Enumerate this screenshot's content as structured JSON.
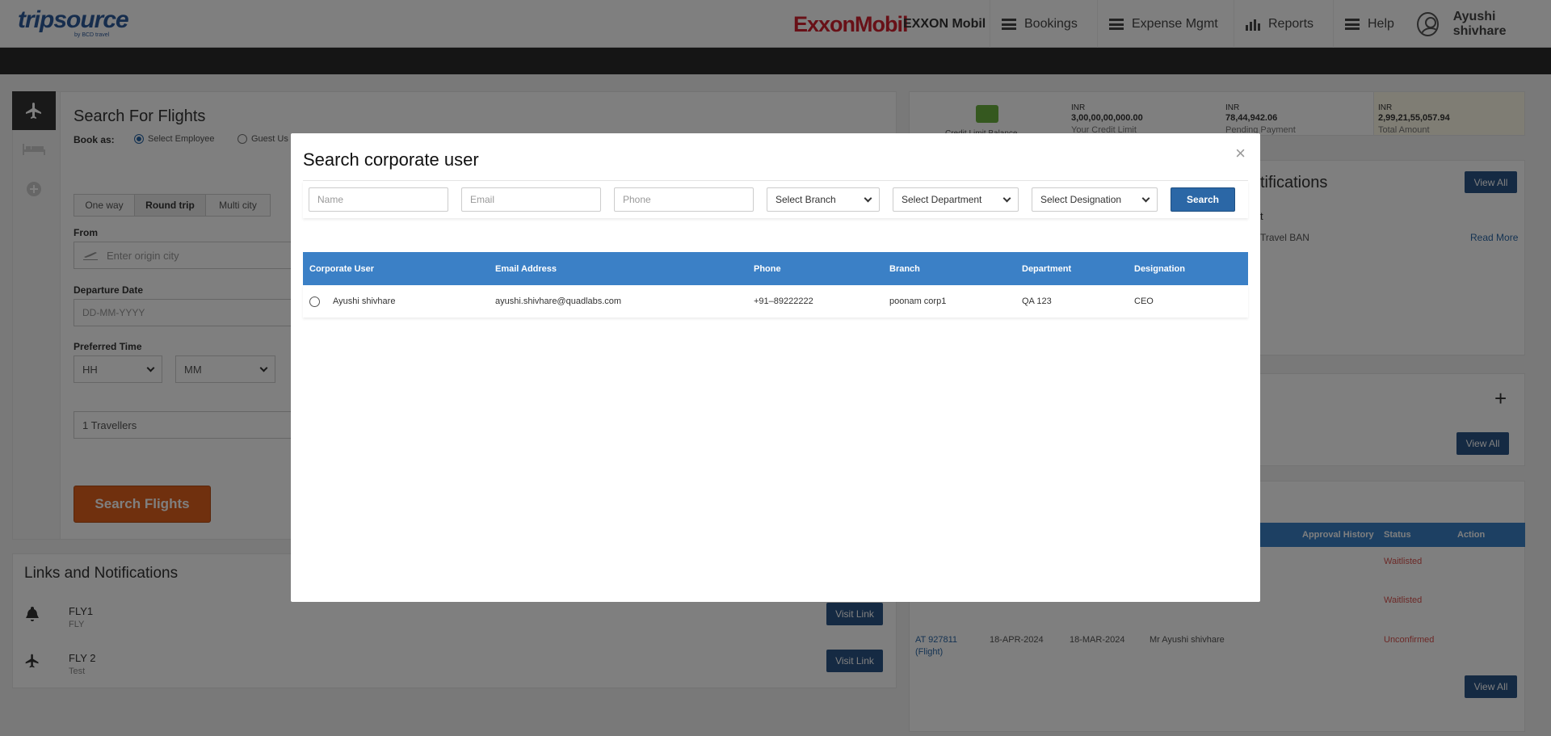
{
  "header": {
    "logo_main": "tripsource",
    "logo_sub": "by BCD travel",
    "client_logo": "ExxonMobil",
    "client_name": "EXXON Mobil",
    "nav": [
      {
        "label": "Bookings",
        "icon": "menu-icon"
      },
      {
        "label": "Expense Mgmt",
        "icon": "menu-icon"
      },
      {
        "label": "Reports",
        "icon": "bar-chart-icon"
      },
      {
        "label": "Help",
        "icon": "menu-icon"
      }
    ],
    "user_name": "Ayushi shivhare"
  },
  "search_flights": {
    "title": "Search For Flights",
    "book_as_label": "Book as:",
    "book_as_options": [
      "Select Employee",
      "Guest Us"
    ],
    "trip_types": [
      "One way",
      "Round trip",
      "Multi city"
    ],
    "from_label": "From",
    "from_placeholder": "Enter origin city",
    "departure_label": "Departure Date",
    "departure_placeholder": "DD-MM-YYYY",
    "time_label": "Preferred Time",
    "hh": "HH",
    "mm": "MM",
    "travellers": "1 Travellers",
    "search_button": "Search Flights"
  },
  "balances": [
    {
      "currency": "INR",
      "amount": "3,00,00,00,000.00",
      "caption": "Your Credit Limit"
    },
    {
      "currency": "INR",
      "amount": "78,44,942.06",
      "caption": "Pending Payment"
    },
    {
      "currency": "INR",
      "amount": "2,99,21,55,057.94",
      "caption": "Total Amount"
    }
  ],
  "credit_caption": "Credit Limit Balance",
  "notifications": {
    "title": "tifications",
    "view_all": "View All",
    "item_title": "t",
    "item_text": "Travel BAN",
    "read_more": "Read More"
  },
  "links": {
    "title": "Links and Notifications",
    "items": [
      {
        "title": "FLY1",
        "sub": "FLY",
        "button": "Visit Link"
      },
      {
        "title": "FLY 2",
        "sub": "Test",
        "button": "Visit Link"
      }
    ]
  },
  "bookings_table": {
    "headers": [
      "Approval History",
      "Status",
      "Action"
    ],
    "rows": [
      {
        "status": "Waitlisted"
      },
      {
        "status": "Waitlisted"
      },
      {
        "pnr": "AT 927811",
        "type": "(Flight)",
        "date1": "18-APR-2024",
        "date2": "18-MAR-2024",
        "name": "Mr Ayushi shivhare",
        "status": "Unconfirmed"
      }
    ],
    "view_all": "View All"
  },
  "other_view_all": "View All",
  "modal": {
    "title": "Search corporate user",
    "close": "×",
    "filters": {
      "name_placeholder": "Name",
      "email_placeholder": "Email",
      "phone_placeholder": "Phone",
      "branch": "Select Branch",
      "department": "Select Department",
      "designation": "Select Designation",
      "search_button": "Search"
    },
    "columns": [
      "Corporate User",
      "Email Address",
      "Phone",
      "Branch",
      "Department",
      "Designation"
    ],
    "rows": [
      {
        "user": "Ayushi shivhare",
        "email": "ayushi.shivhare@quadlabs.com",
        "phone": "+91–89222222",
        "branch": "poonam corp1",
        "department": "QA 123",
        "designation": "CEO"
      }
    ]
  }
}
